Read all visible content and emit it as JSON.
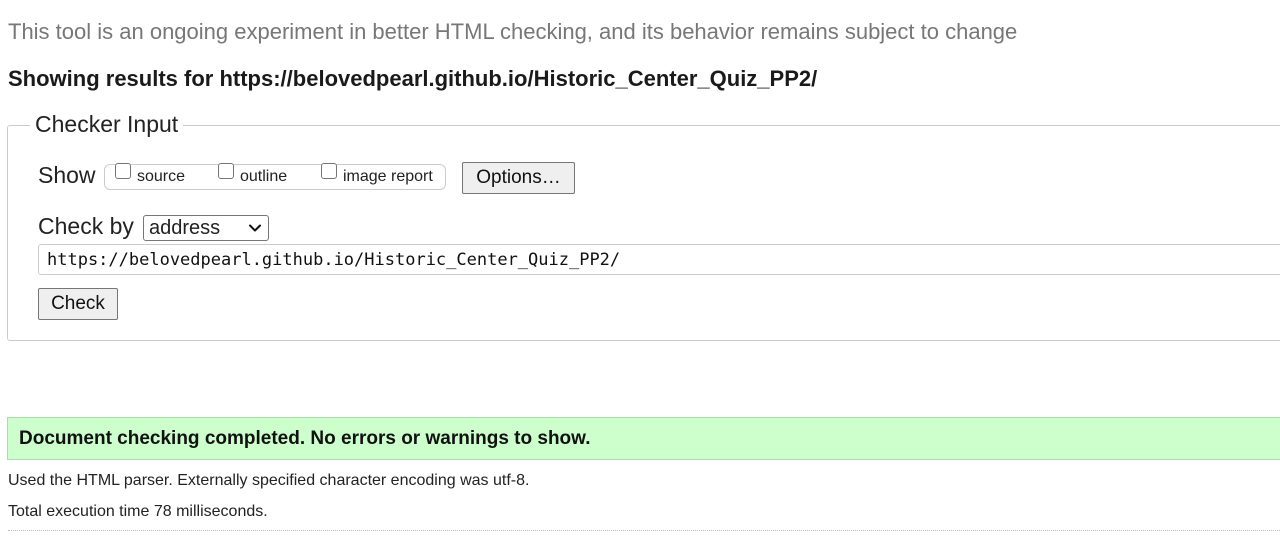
{
  "intro": "This tool is an ongoing experiment in better HTML checking, and its behavior remains subject to change",
  "results": {
    "prefix": "Showing results for ",
    "url": "https://belovedpearl.github.io/Historic_Center_Quiz_PP2/"
  },
  "checker": {
    "legend": "Checker Input",
    "show_label": "Show",
    "options": [
      {
        "label": "source",
        "checked": false
      },
      {
        "label": "outline",
        "checked": false
      },
      {
        "label": "image report",
        "checked": false
      }
    ],
    "options_button": "Options…",
    "check_by_label": "Check by",
    "check_by_value": "address",
    "url_value": "https://belovedpearl.github.io/Historic_Center_Quiz_PP2/",
    "check_button": "Check"
  },
  "result_message": "Document checking completed. No errors or warnings to show.",
  "info": {
    "parser": "Used the HTML parser. Externally specified character encoding was utf-8.",
    "time": "Total execution time 78 milliseconds."
  },
  "colors": {
    "success_bg": "#ccffcc",
    "intro_text": "#777777"
  }
}
